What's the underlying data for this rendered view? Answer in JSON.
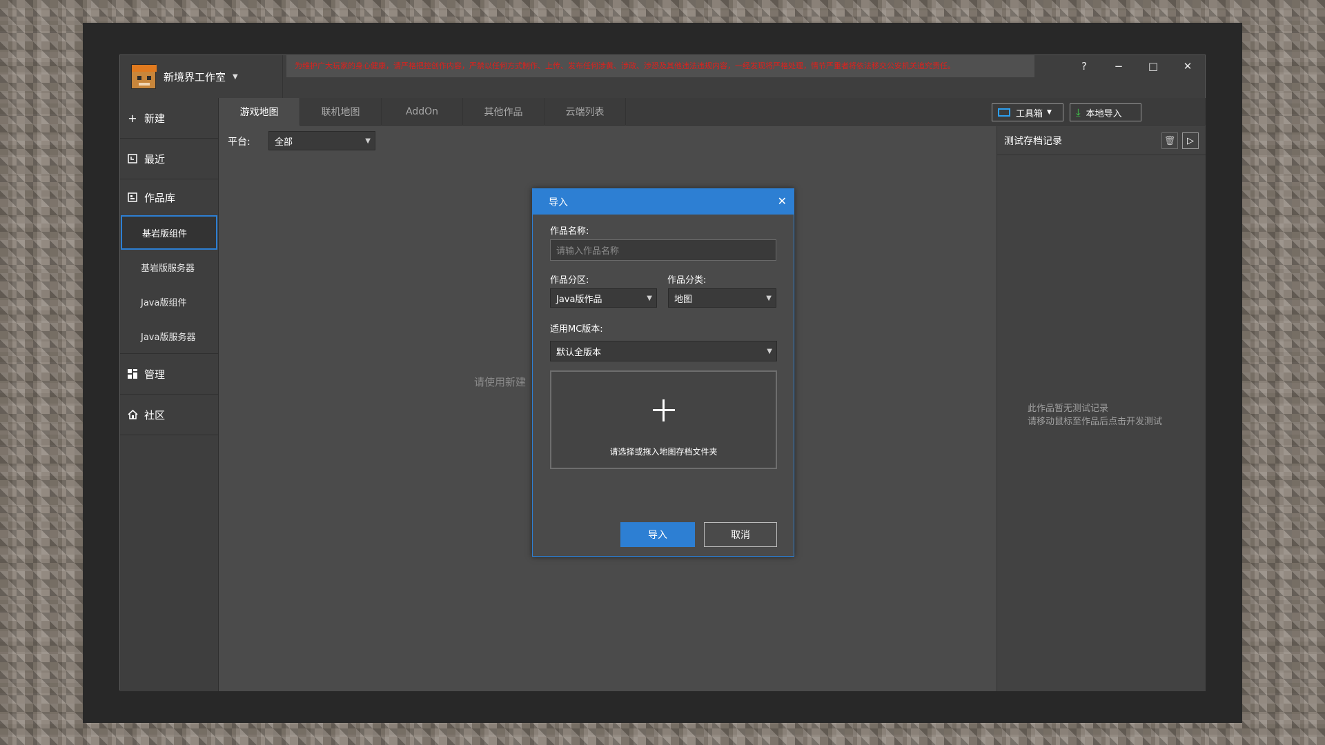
{
  "app": {
    "name": "新境界工作室",
    "notice": "为维护广大玩家的身心健康，请严格把控创作内容，严禁以任何方式制作、上传、发布任何涉黄、涉政、涉恐及其他违法违规内容，一经发现将严格处理，情节严重者将依法移交公安机关追究责任。"
  },
  "window": {
    "help": "?",
    "minimize": "−",
    "maximize": "□",
    "close": "✕"
  },
  "sidebar": {
    "new": "新建",
    "recent": "最近",
    "library": "作品库",
    "library_items": [
      "基岩版组件",
      "基岩版服务器",
      "Java版组件",
      "Java版服务器"
    ],
    "manage": "管理",
    "community": "社区"
  },
  "tabs": [
    "游戏地图",
    "联机地图",
    "AddOn",
    "其他作品",
    "云端列表"
  ],
  "toolbar": {
    "toolbox": "工具箱",
    "local_import": "本地导入"
  },
  "filter": {
    "platform_label": "平台:",
    "platform_value": "全部"
  },
  "main": {
    "empty_hint": "请使用新建"
  },
  "right_panel": {
    "title": "测试存档记录",
    "empty_line1": "此作品暂无测试记录",
    "empty_line2": "请移动鼠标至作品后点击开发测试"
  },
  "dialog": {
    "title": "导入",
    "name_label": "作品名称:",
    "name_placeholder": "请输入作品名称",
    "zone_label": "作品分区:",
    "zone_value": "Java版作品",
    "category_label": "作品分类:",
    "category_value": "地图",
    "version_label": "适用MC版本:",
    "version_value": "默认全版本",
    "drop_text": "请选择或拖入地图存档文件夹",
    "confirm": "导入",
    "cancel": "取消"
  },
  "colors": {
    "accent": "#2d7fd3",
    "notice": "#e0201c",
    "bg": "#4b4b4b"
  }
}
